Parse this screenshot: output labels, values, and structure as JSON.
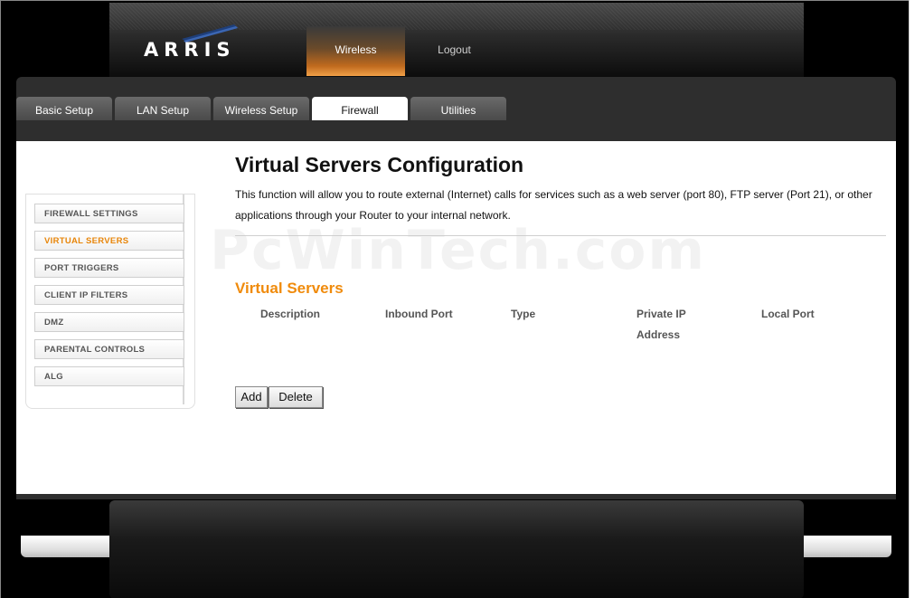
{
  "brand": {
    "logo_text": "ARRIS"
  },
  "top_nav": {
    "wireless": "Wireless",
    "logout": "Logout"
  },
  "tabs": [
    {
      "label": "Basic Setup",
      "active": false
    },
    {
      "label": "LAN Setup",
      "active": false
    },
    {
      "label": "Wireless Setup",
      "active": false
    },
    {
      "label": "Firewall",
      "active": true
    },
    {
      "label": "Utilities",
      "active": false
    }
  ],
  "sidebar": {
    "items": [
      {
        "label": "FIREWALL SETTINGS",
        "active": false
      },
      {
        "label": "VIRTUAL SERVERS",
        "active": true
      },
      {
        "label": "PORT TRIGGERS",
        "active": false
      },
      {
        "label": "CLIENT IP FILTERS",
        "active": false
      },
      {
        "label": "DMZ",
        "active": false
      },
      {
        "label": "PARENTAL CONTROLS",
        "active": false
      },
      {
        "label": "ALG",
        "active": false
      }
    ]
  },
  "main": {
    "title": "Virtual Servers Configuration",
    "description": "This function will allow you to route external (Internet) calls for services such as a web server (port 80), FTP server (Port 21), or other applications through your Router to your internal network.",
    "watermark": "PcWinTech.com",
    "section_title": "Virtual Servers",
    "columns": [
      "Description",
      "Inbound Port",
      "Type",
      "Private IP Address",
      "Local Port"
    ],
    "add_label": "Add",
    "delete_label": "Delete"
  },
  "colors": {
    "accent": "#f08b0c",
    "active_sidebar": "#e8860a",
    "frame": "#000000"
  }
}
